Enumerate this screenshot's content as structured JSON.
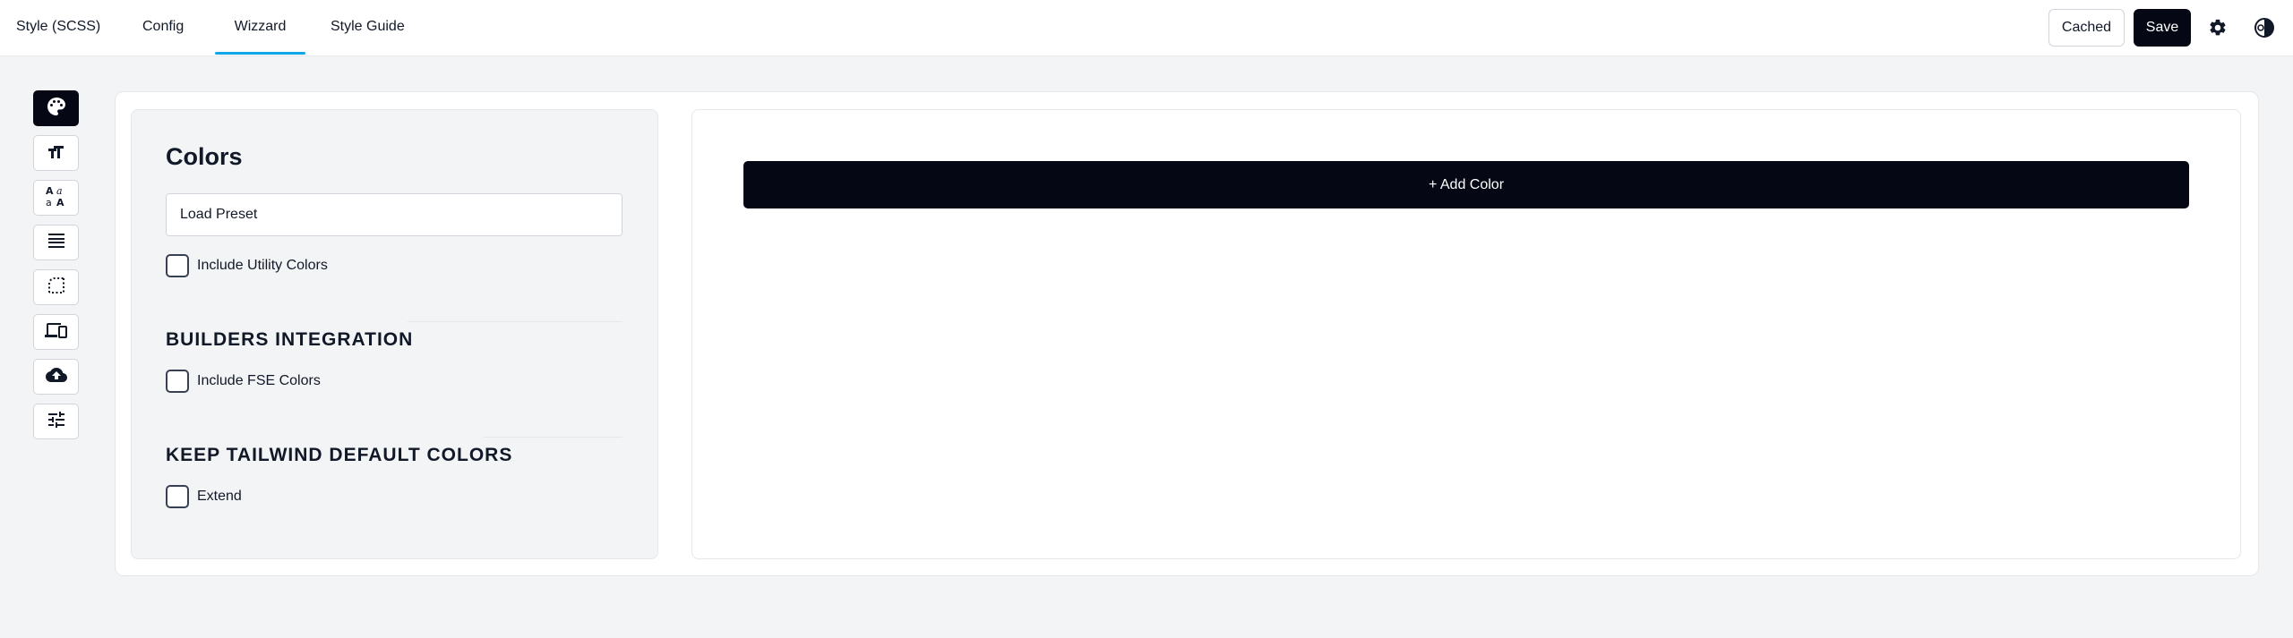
{
  "tabs": [
    {
      "label": "Style (SCSS)"
    },
    {
      "label": "Config"
    },
    {
      "label": "Wizzard"
    },
    {
      "label": "Style Guide"
    }
  ],
  "active_tab": "Wizzard",
  "toolbar": {
    "cached_label": "Cached",
    "save_label": "Save",
    "settings_icon": "gear-icon",
    "theme_icon": "contrast-icon"
  },
  "rail": [
    {
      "icon": "palette-icon"
    },
    {
      "icon": "text-size-icon"
    },
    {
      "icon": "font-icon"
    },
    {
      "icon": "lines-icon"
    },
    {
      "icon": "border-radius-icon"
    },
    {
      "icon": "devices-icon"
    },
    {
      "icon": "cloud-upload-icon"
    },
    {
      "icon": "sliders-icon"
    }
  ],
  "colors_panel": {
    "title": "Colors",
    "preset_value": "Load Preset",
    "utility_label": "Include Utility Colors",
    "builders_heading": "BUILDERS INTEGRATION",
    "fse_label": "Include FSE Colors",
    "tailwind_heading": "KEEP TAILWIND DEFAULT COLORS",
    "extend_label": "Extend"
  },
  "add_color_label": "+ Add Color",
  "colors": {
    "accent": "#0ea5e9",
    "dark": "#050814",
    "background": "#f3f4f6"
  }
}
